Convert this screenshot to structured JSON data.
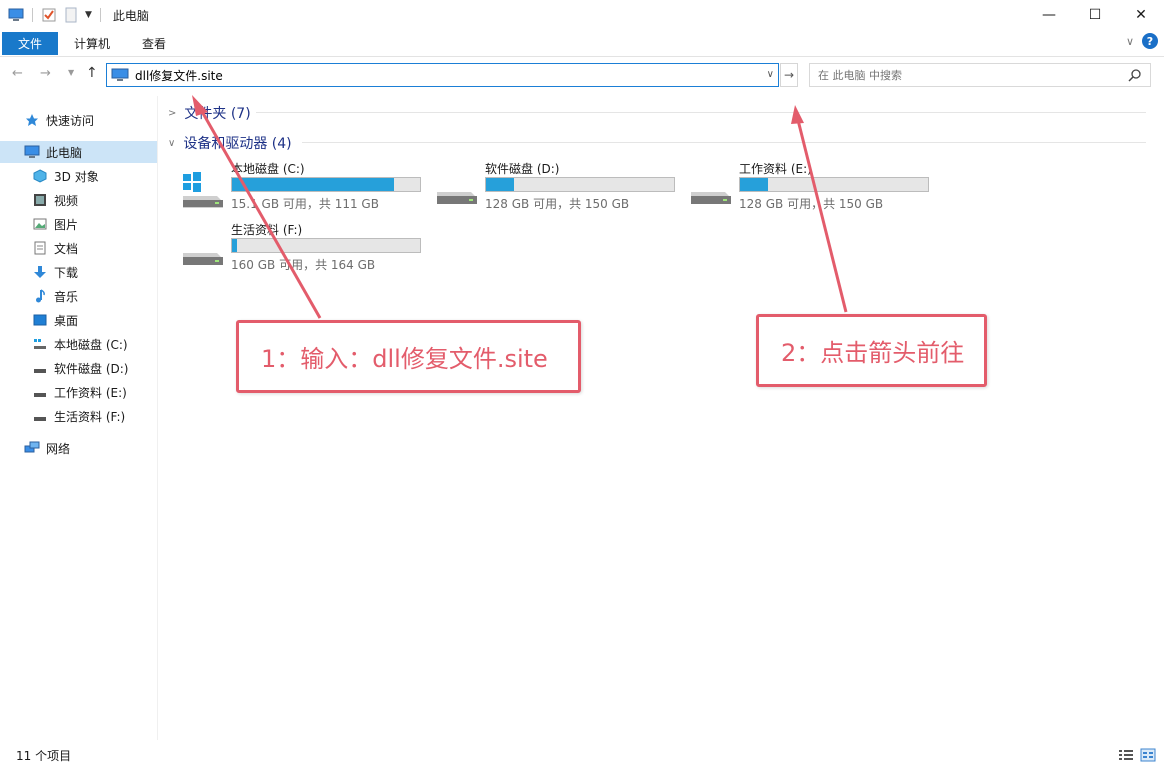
{
  "window": {
    "title": "此电脑",
    "controls": {
      "minimize": "—",
      "maximize": "☐",
      "close": "✕"
    }
  },
  "ribbon": {
    "tabs": [
      {
        "label": "文件",
        "active": true
      },
      {
        "label": "计算机"
      },
      {
        "label": "查看"
      }
    ],
    "help": "?"
  },
  "address": {
    "value": "dll修复文件.site"
  },
  "search": {
    "placeholder": "在 此电脑 中搜索"
  },
  "sidebar": {
    "items": [
      {
        "label": "快速访问",
        "icon": "star-icon"
      },
      {
        "label": "此电脑",
        "icon": "computer-icon",
        "selected": true
      },
      {
        "label": "3D 对象",
        "icon": "cube-icon"
      },
      {
        "label": "视频",
        "icon": "video-icon"
      },
      {
        "label": "图片",
        "icon": "picture-icon"
      },
      {
        "label": "文档",
        "icon": "document-icon"
      },
      {
        "label": "下载",
        "icon": "download-icon"
      },
      {
        "label": "音乐",
        "icon": "music-icon"
      },
      {
        "label": "桌面",
        "icon": "desktop-icon"
      },
      {
        "label": "本地磁盘 (C:)",
        "icon": "system-drive-icon"
      },
      {
        "label": "软件磁盘 (D:)",
        "icon": "drive-icon"
      },
      {
        "label": "工作资料 (E:)",
        "icon": "drive-icon"
      },
      {
        "label": "生活资料 (F:)",
        "icon": "drive-icon"
      },
      {
        "label": "网络",
        "icon": "network-icon"
      }
    ]
  },
  "groups": {
    "folders": "文件夹 (7)",
    "devices": "设备和驱动器 (4)"
  },
  "drives": [
    {
      "name": "本地磁盘 (C:)",
      "info": "15.1 GB 可用，共 111 GB",
      "used_fraction": 0.864,
      "icon": "system-drive-icon"
    },
    {
      "name": "软件磁盘 (D:)",
      "info": "128 GB 可用，共 150 GB",
      "used_fraction": 0.147,
      "icon": "drive-icon"
    },
    {
      "name": "工作资料 (E:)",
      "info": "128 GB 可用，共 150 GB",
      "used_fraction": 0.147,
      "icon": "drive-icon"
    },
    {
      "name": "生活资料 (F:)",
      "info": "160 GB 可用，共 164 GB",
      "used_fraction": 0.024,
      "icon": "drive-icon"
    }
  ],
  "status": {
    "count": "11 个项目"
  },
  "annotations": {
    "step1": "1：输入：dll修复文件.site",
    "step2": "2：点击箭头前往",
    "color": "#e35c6b"
  }
}
